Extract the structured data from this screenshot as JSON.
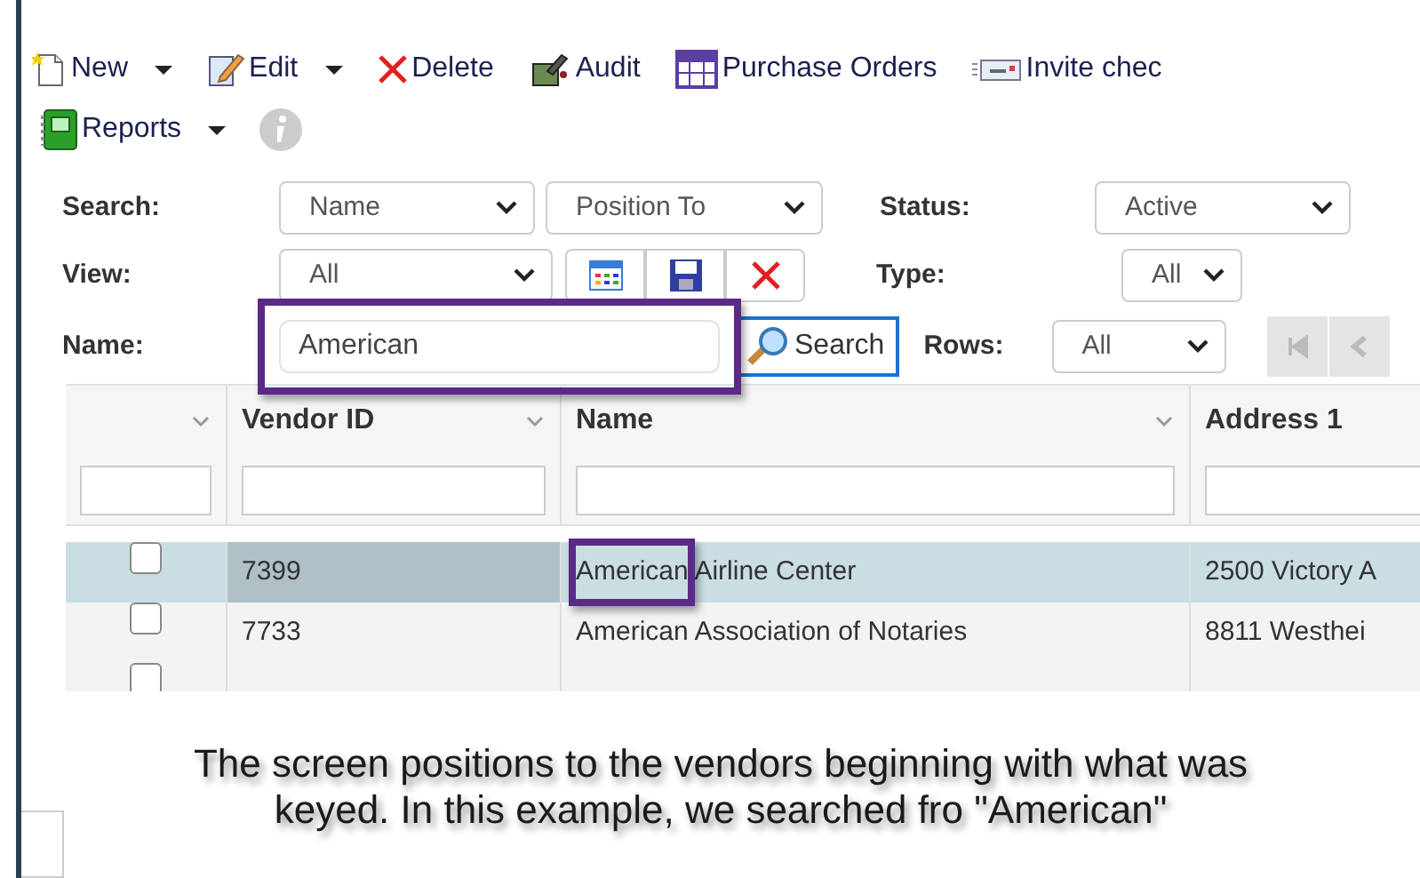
{
  "toolbar": [
    {
      "kind": "new",
      "label": "New",
      "dropdown": true
    },
    {
      "kind": "edit",
      "label": "Edit",
      "dropdown": true
    },
    {
      "kind": "delete",
      "label": "Delete",
      "dropdown": false
    },
    {
      "kind": "audit",
      "label": "Audit",
      "dropdown": false
    },
    {
      "kind": "orders",
      "label": "Purchase Orders",
      "dropdown": false
    },
    {
      "kind": "invite",
      "label": "Invite chec",
      "dropdown": false
    },
    {
      "kind": "reports",
      "label": "Reports",
      "dropdown": true
    },
    {
      "kind": "info",
      "disabled": true
    }
  ],
  "filters": {
    "search_label": "Search:",
    "search_by": "Name",
    "search_mode": "Position To",
    "status_label": "Status:",
    "status": "Active",
    "view_label": "View:",
    "view": "All",
    "type_label": "Type:",
    "type": "All",
    "name_label": "Name:",
    "name_value": "American",
    "name_highlighted": true,
    "search_button": "Search",
    "rows_label": "Rows:",
    "rows": "All",
    "pager_disabled": true
  },
  "grid": {
    "columns": [
      {
        "kind": "check"
      },
      {
        "kind": "text",
        "label": "Vendor ID"
      },
      {
        "kind": "text",
        "label": "Name"
      },
      {
        "kind": "text",
        "label": "Address 1"
      }
    ],
    "rows": [
      {
        "selected": true,
        "checked": false,
        "vendor_id": "7399",
        "name": "American Airline Center",
        "name_highlighted": true,
        "address": "2500 Victory A"
      },
      {
        "selected": false,
        "checked": false,
        "vendor_id": "7733",
        "name": "American Association of Notaries",
        "name_highlighted": false,
        "address": "8811 Westhei"
      },
      {
        "selected": false,
        "checked": false
      }
    ]
  },
  "caption": "The screen positions to the vendors beginning with what was keyed. In this example, we searched fro \"American\""
}
